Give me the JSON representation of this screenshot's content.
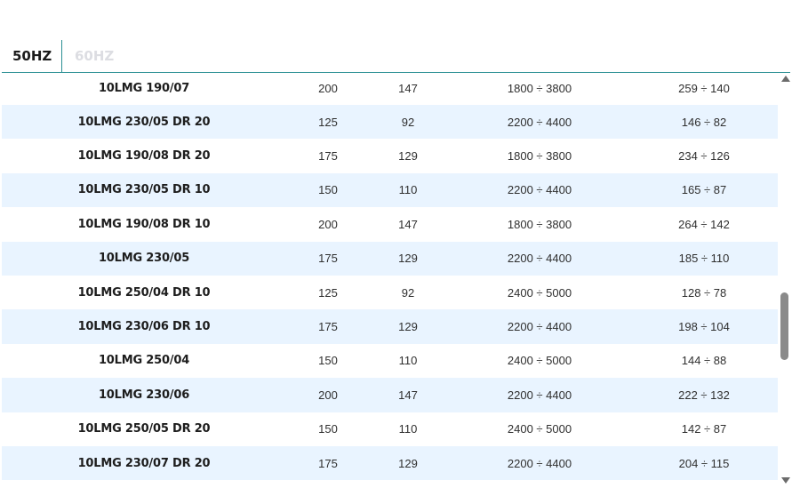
{
  "tabs": {
    "hz50": "50HZ",
    "hz60": "60HZ"
  },
  "rows": [
    [
      "10LMG 190/07",
      "200",
      "147",
      "1800 ÷ 3800",
      "259 ÷ 140"
    ],
    [
      "10LMG 230/05 DR 20",
      "125",
      "92",
      "2200 ÷ 4400",
      "146 ÷ 82"
    ],
    [
      "10LMG 190/08 DR 20",
      "175",
      "129",
      "1800 ÷ 3800",
      "234 ÷ 126"
    ],
    [
      "10LMG 230/05 DR 10",
      "150",
      "110",
      "2200 ÷ 4400",
      "165 ÷ 87"
    ],
    [
      "10LMG 190/08 DR 10",
      "200",
      "147",
      "1800 ÷ 3800",
      "264 ÷ 142"
    ],
    [
      "10LMG 230/05",
      "175",
      "129",
      "2200 ÷ 4400",
      "185 ÷ 110"
    ],
    [
      "10LMG 250/04 DR 10",
      "125",
      "92",
      "2400 ÷ 5000",
      "128 ÷ 78"
    ],
    [
      "10LMG 230/06 DR 10",
      "175",
      "129",
      "2200 ÷ 4400",
      "198 ÷ 104"
    ],
    [
      "10LMG 250/04",
      "150",
      "110",
      "2400 ÷ 5000",
      "144 ÷ 88"
    ],
    [
      "10LMG 230/06",
      "200",
      "147",
      "2200 ÷ 4400",
      "222 ÷ 132"
    ],
    [
      "10LMG 250/05 DR 20",
      "150",
      "110",
      "2400 ÷ 5000",
      "142 ÷ 87"
    ],
    [
      "10LMG 230/07 DR 20",
      "175",
      "129",
      "2200 ÷ 4400",
      "204 ÷ 115"
    ]
  ],
  "colors": {
    "accent": "#2a8f93",
    "row_alt": "#e9f4ff",
    "tab_inactive": "#dcdde2"
  }
}
